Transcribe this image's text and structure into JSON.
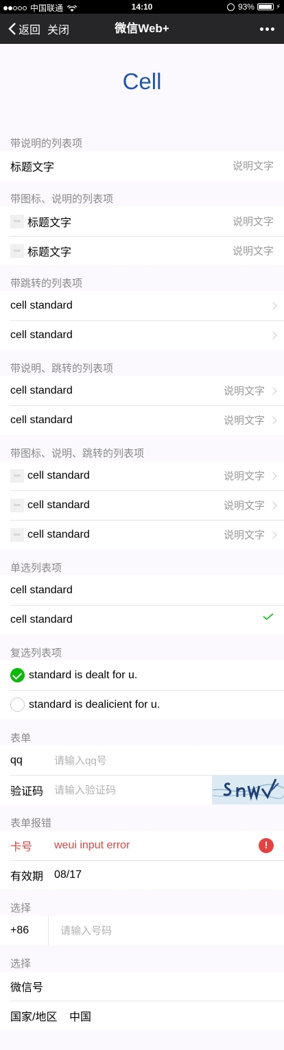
{
  "status_bar": {
    "carrier": "中国联通",
    "time": "14:10",
    "battery": "93%",
    "battery_level": 0.93
  },
  "nav": {
    "back": "返回",
    "close": "关闭",
    "title": "微信Web+"
  },
  "page_title": "Cell",
  "icon_text": "icon",
  "sections": {
    "s1": "带说明的列表项",
    "s2": "带图标、说明的列表项",
    "s3": "带跳转的列表项",
    "s4": "带说明、跳转的列表项",
    "s5": "带图标、说明、跳转的列表项",
    "s6": "单选列表项",
    "s7": "复选列表项",
    "s8": "表单",
    "s9": "表单报错",
    "s10": "选择",
    "s11": "选择"
  },
  "cells": {
    "title": "标题文字",
    "desc": "说明文字",
    "standard": "cell standard"
  },
  "checkbox": {
    "item1": "standard is dealt for u.",
    "item2": "standard is dealicient for u."
  },
  "form": {
    "qq_label": "qq",
    "qq_placeholder": "请输入qq号",
    "code_label": "验证码",
    "code_placeholder": "请输入验证码"
  },
  "form_error": {
    "card_label": "卡号",
    "card_value": "weui input error",
    "expiry_label": "有效期",
    "expiry_value": "08/17"
  },
  "select1": {
    "prefix": "+86",
    "placeholder": "请输入号码"
  },
  "select2": {
    "wechat_label": "微信号",
    "country_label": "国家/地区",
    "country_value": "中国"
  },
  "colors": {
    "accent": "#1f56a7",
    "nav": "#262629",
    "success": "#09bb07",
    "error": "#e64340"
  }
}
